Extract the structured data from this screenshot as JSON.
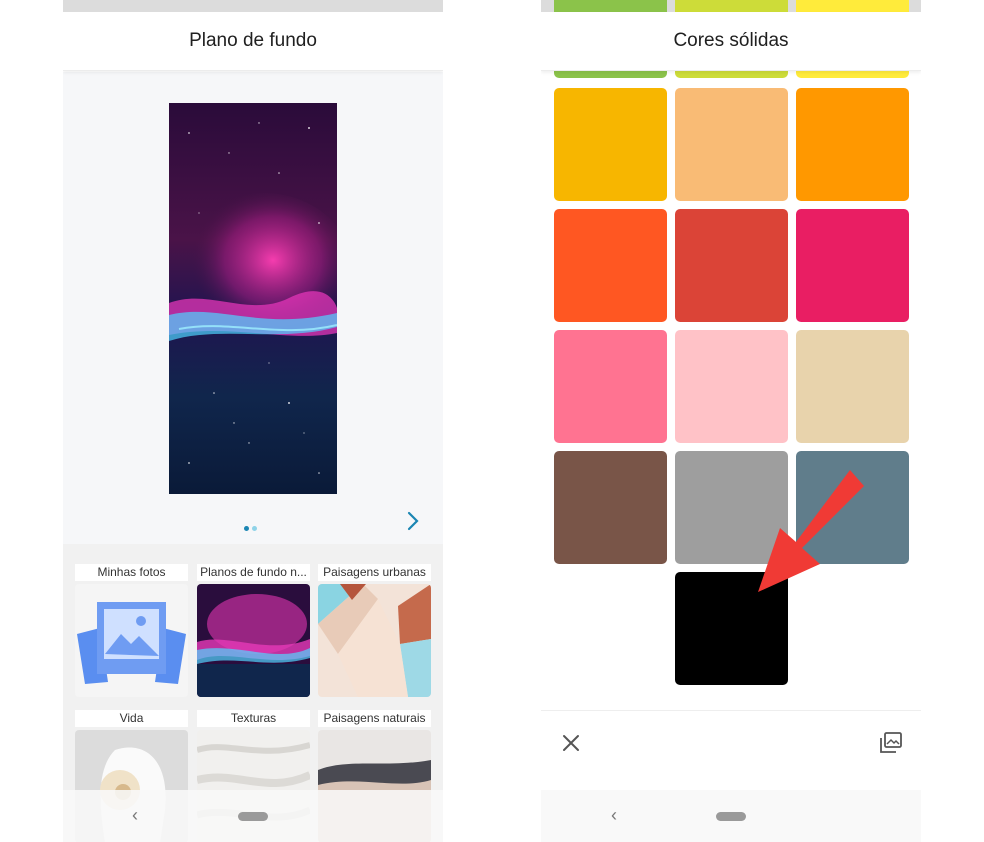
{
  "left_screen": {
    "title": "Plano de fundo",
    "page_indicator": {
      "current": 1,
      "total": 2
    },
    "categories": [
      {
        "label": "Minhas fotos",
        "thumb": "photos-illustration"
      },
      {
        "label": "Planos de fundo n...",
        "thumb": "nebula"
      },
      {
        "label": "Paisagens urbanas",
        "thumb": "architecture"
      },
      {
        "label": "Vida",
        "thumb": "flower"
      },
      {
        "label": "Texturas",
        "thumb": "fabric"
      },
      {
        "label": "Paisagens naturais",
        "thumb": "dunes"
      }
    ],
    "nav": {
      "back_glyph": "‹"
    }
  },
  "right_screen": {
    "title": "Cores sólidas",
    "partial_row_colors": [
      "#8bc34a",
      "#cddc39",
      "#ffeb3b"
    ],
    "swatches": [
      "#f7b600",
      "#f9bb75",
      "#ff9800",
      "#ff5722",
      "#db4437",
      "#e91e63",
      "#ff7391",
      "#ffc2c7",
      "#e8d3ac",
      "#795548",
      "#9e9e9e",
      "#607d8b",
      "#000000"
    ],
    "selected_swatch": "#000000",
    "icons": {
      "close": "close-icon",
      "apply": "set-wallpaper-icon",
      "annotation": "red-arrow-icon"
    },
    "nav": {
      "back_glyph": "‹"
    }
  },
  "colors": {
    "accent": "#1b86b3",
    "annotation_arrow": "#f03a35"
  }
}
